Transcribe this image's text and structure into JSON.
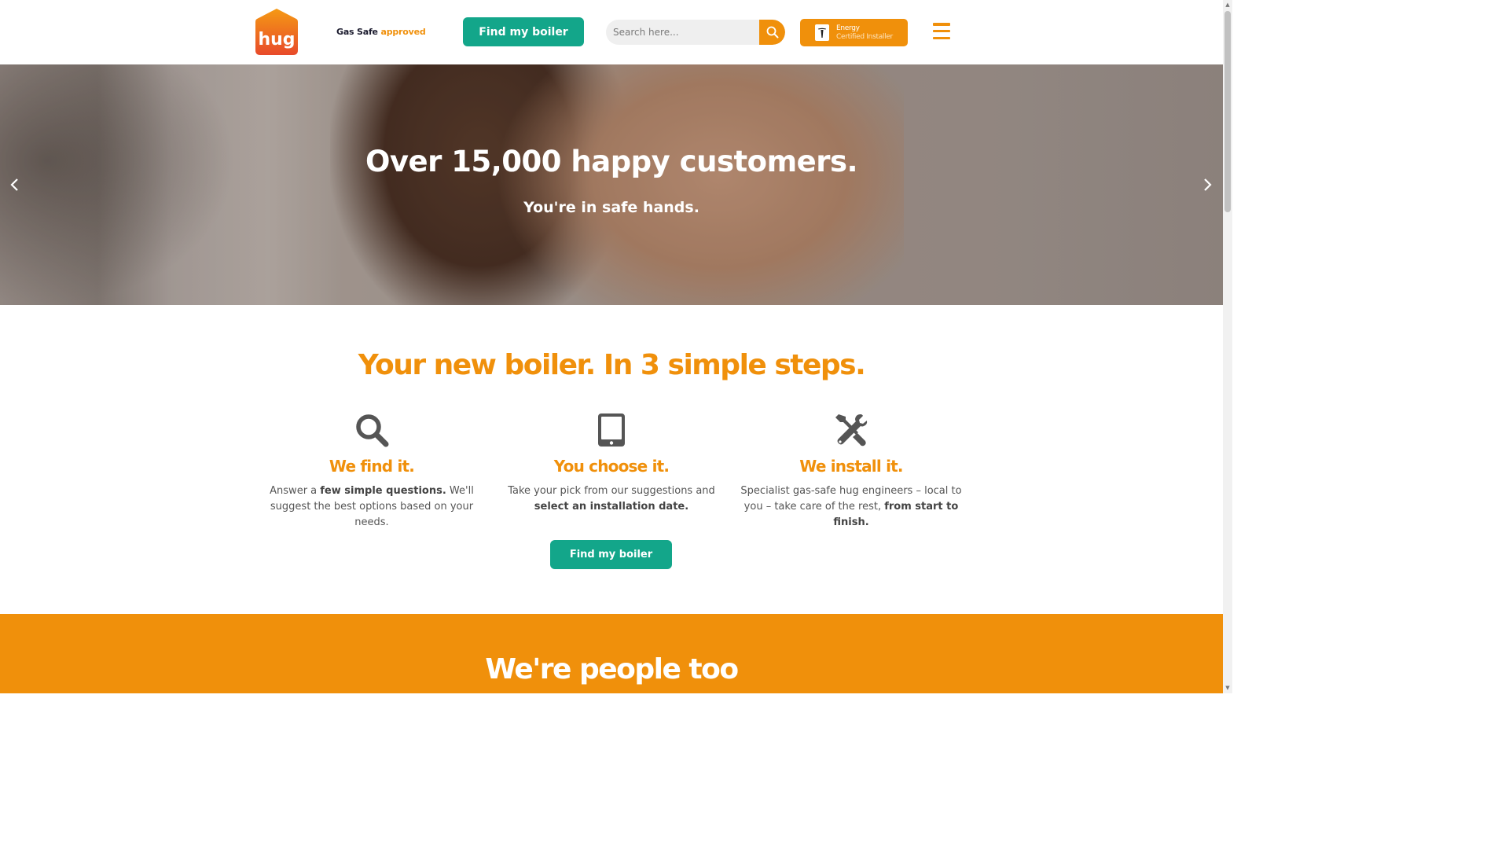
{
  "header": {
    "logo_text": "hug",
    "gas_safe_prefix": "Gas Safe",
    "gas_safe_suffix": "approved",
    "cta_label": "Find my boiler",
    "search_placeholder": "Search here...",
    "tesla_line1": "Energy",
    "tesla_line2": "Certified Installer",
    "tesla_icon": "tesla-logo-icon",
    "menu_icon": "hamburger-menu-icon"
  },
  "hero": {
    "title": "Over 15,000 happy customers.",
    "subtitle": "You're in safe hands.",
    "prev_icon": "chevron-left-icon",
    "next_icon": "chevron-right-icon"
  },
  "steps": {
    "title": "Your new boiler. In 3 simple steps.",
    "items": [
      {
        "icon": "magnifier-icon",
        "title": "We find it.",
        "text_before": "Answer a ",
        "text_bold": "few simple questions.",
        "text_after": " We'll suggest the best options based on your needs."
      },
      {
        "icon": "tablet-icon",
        "title": "You choose it.",
        "text_before": "Take your pick from our suggestions and ",
        "text_bold": "select an installation date.",
        "text_after": ""
      },
      {
        "icon": "tools-icon",
        "title": "We install it.",
        "text_before": "Specialist gas-safe hug engineers – local to you – take care of the rest, ",
        "text_bold": "from start to finish.",
        "text_after": ""
      }
    ],
    "cta_label": "Find my boiler"
  },
  "people": {
    "title": "We're people too"
  },
  "colors": {
    "brand_orange": "#f0900b",
    "brand_green": "#13a68a",
    "logo_red": "#e8502a"
  }
}
